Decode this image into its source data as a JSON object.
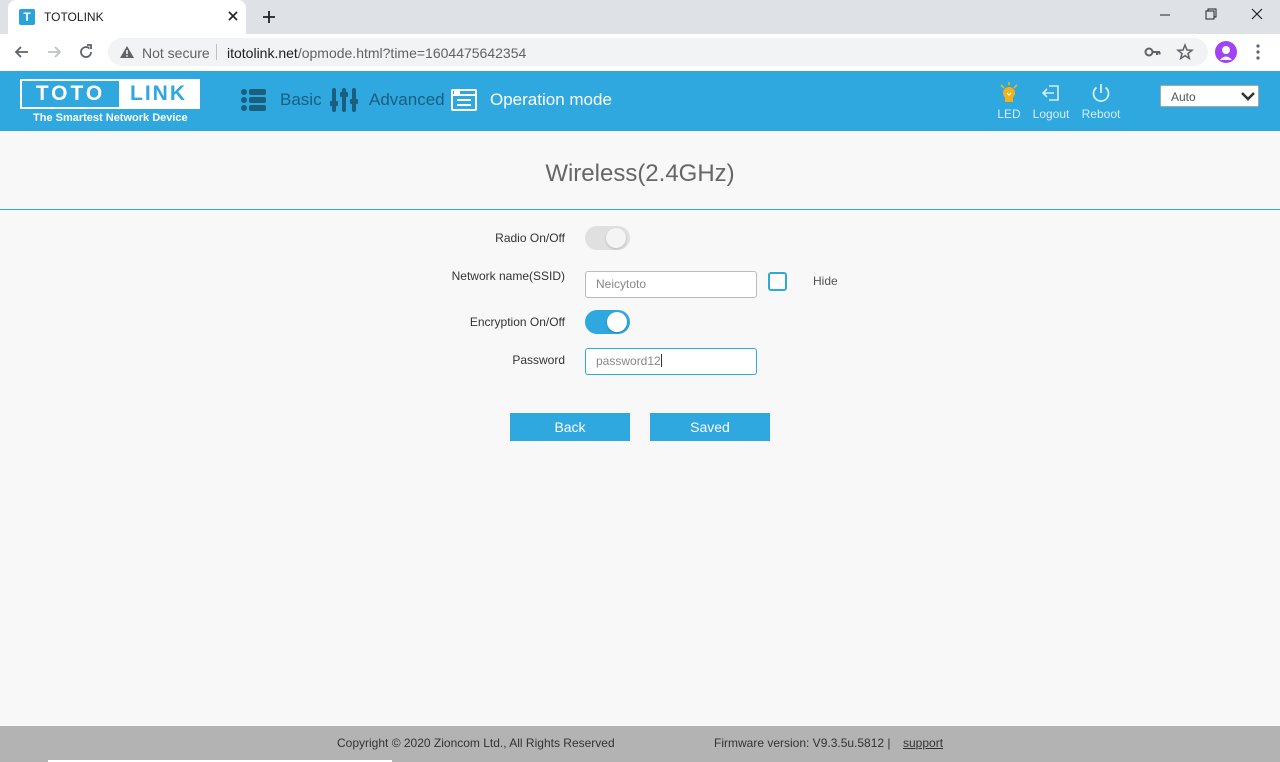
{
  "browser": {
    "tab_title": "TOTOLINK",
    "favicon_letter": "T",
    "security_label": "Not secure",
    "url_host": "itotolink.net",
    "url_path": "/opmode.html?time=1604475642354"
  },
  "header": {
    "logo_left": "TOTO",
    "logo_right": "LINK",
    "tagline": "The Smartest Network Device",
    "nav": {
      "basic": "Basic",
      "advanced": "Advanced",
      "operation_mode": "Operation mode"
    },
    "led_label": "LED",
    "logout_label": "Logout",
    "reboot_label": "Reboot",
    "language": "Auto"
  },
  "page": {
    "title": "Wireless(2.4GHz)",
    "radio_label": "Radio On/Off",
    "radio_on": false,
    "ssid_label": "Network name(SSID)",
    "ssid_value": "Neicytoto",
    "hide_label": "Hide",
    "hide_checked": false,
    "encryption_label": "Encryption On/Off",
    "encryption_on": true,
    "password_label": "Password",
    "password_value": "password12",
    "back_label": "Back",
    "save_label": "Saved"
  },
  "footer": {
    "copyright": "Copyright © 2020 Zioncom Ltd., All Rights Reserved",
    "firmware": "Firmware version: V9.3.5u.5812  |",
    "support": "support"
  },
  "colors": {
    "accent": "#2ea8de",
    "footer_bg": "#b3b3b3",
    "page_bg": "#f8f8f8"
  }
}
